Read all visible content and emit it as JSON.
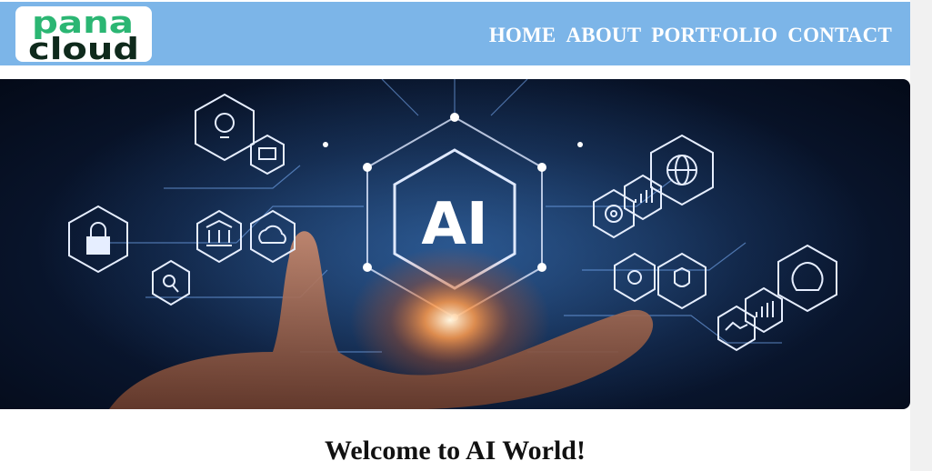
{
  "brand": {
    "logo_line1": "pana",
    "logo_line2": "cloud"
  },
  "nav": {
    "items": [
      "HOME",
      "ABOUT",
      "PORTFOLIO",
      "CONTACT"
    ]
  },
  "hero": {
    "badge_text": "AI"
  },
  "main": {
    "heading": "Welcome to AI World!"
  },
  "colors": {
    "navbar": "#7cb5e8",
    "logo_green": "#2bb673",
    "logo_dark": "#0f2a1c",
    "hero_glow": "#ff8a3c"
  }
}
